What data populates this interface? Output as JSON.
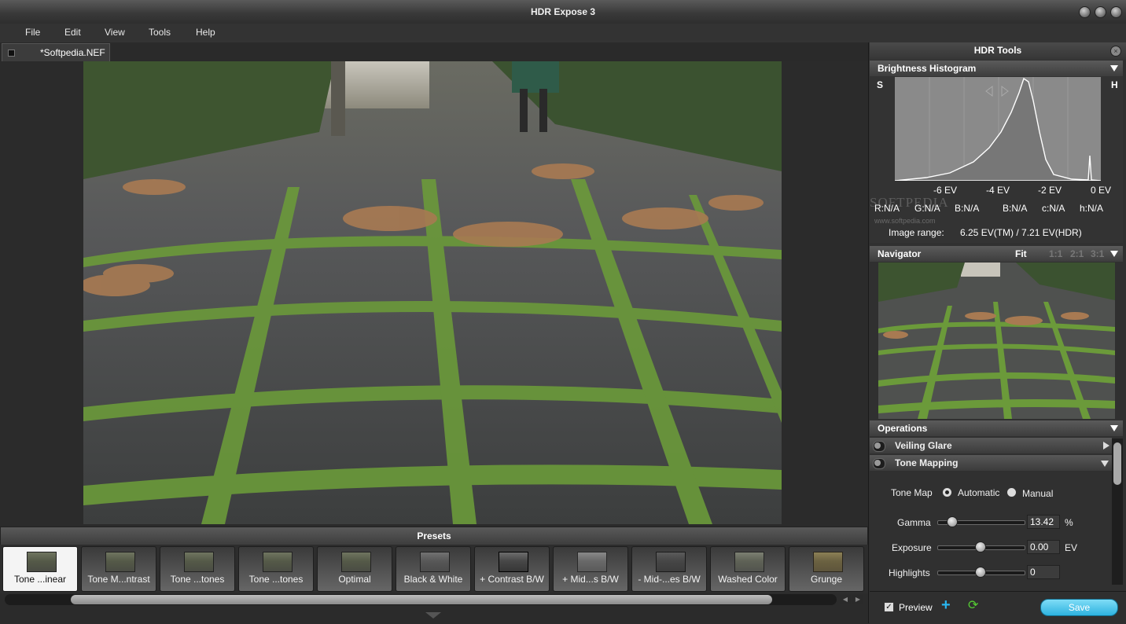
{
  "window": {
    "title": "HDR Expose 3"
  },
  "menu": [
    "File",
    "Edit",
    "View",
    "Tools",
    "Help"
  ],
  "document_tab": {
    "label": "*Softpedia.NEF"
  },
  "presets": {
    "title": "Presets",
    "items": [
      "Tone ...inear",
      "Tone M...ntrast",
      "Tone ...tones",
      "Tone ...tones",
      "Optimal",
      "Black & White",
      "+ Contrast B/W",
      "+ Mid...s B/W",
      "- Mid-...es B/W",
      "Washed Color",
      "Grunge"
    ],
    "selected_index": 0
  },
  "hdr_tools": {
    "title": "HDR Tools",
    "histogram": {
      "title": "Brightness Histogram",
      "left_marker": "S",
      "right_marker": "H",
      "ev_labels": [
        "-6 EV",
        "-4 EV",
        "-2 EV",
        "0 EV"
      ],
      "stats": {
        "r": "R:N/A",
        "g": "G:N/A",
        "b": "B:N/A",
        "b2": "B:N/A",
        "c": "c:N/A",
        "h": "h:N/A"
      },
      "image_range_label": "Image range:",
      "image_range_value": "6.25 EV(TM) / 7.21 EV(HDR)"
    },
    "navigator": {
      "title": "Navigator",
      "zoom": [
        "Fit",
        "1:1",
        "2:1",
        "3:1"
      ],
      "active_zoom": "Fit"
    },
    "operations": {
      "title": "Operations",
      "sections": [
        "Veiling Glare",
        "Tone Mapping"
      ],
      "tone_map": {
        "label": "Tone Map",
        "options": [
          "Automatic",
          "Manual"
        ],
        "selected": "Automatic"
      },
      "sliders": [
        {
          "label": "Gamma",
          "value": "13.42",
          "unit": "%",
          "fraction": 0.17
        },
        {
          "label": "Exposure",
          "value": "0.00",
          "unit": "EV",
          "fraction": 0.5
        },
        {
          "label": "Highlights",
          "value": "0",
          "unit": "",
          "fraction": 0.5
        }
      ]
    },
    "footer": {
      "preview_label": "Preview",
      "preview_checked": true,
      "save_label": "Save"
    }
  },
  "watermark": {
    "brand": "SOFTPEDIA",
    "url": "www.softpedia.com"
  }
}
